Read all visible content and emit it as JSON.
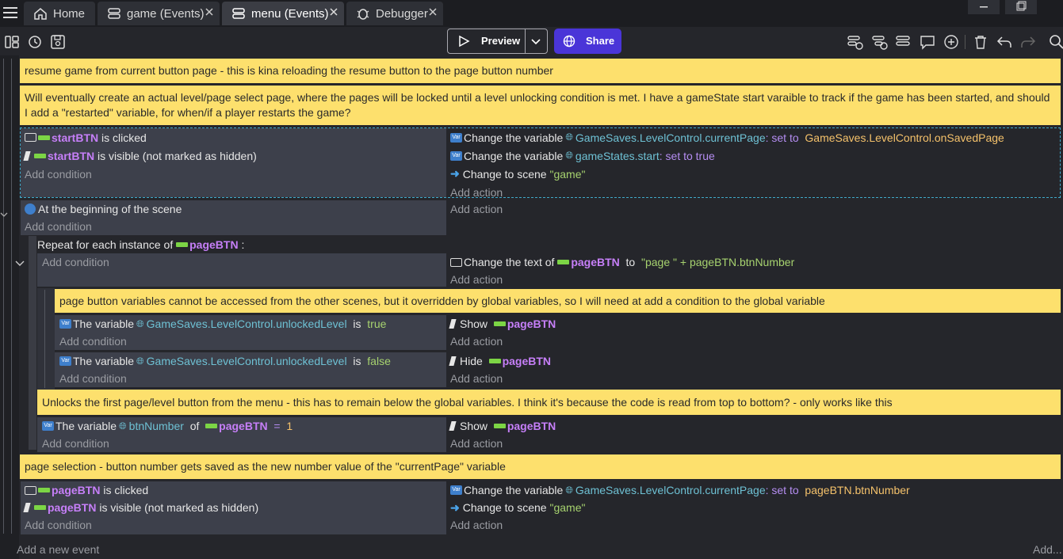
{
  "tabs": [
    {
      "label": "Home",
      "icon": "home-icon"
    },
    {
      "label": "game (Events)",
      "icon": "events-icon"
    },
    {
      "label": "menu (Events)",
      "icon": "events-icon"
    },
    {
      "label": "Debugger",
      "icon": "bug-icon"
    }
  ],
  "toolbar": {
    "preview_label": "Preview",
    "share_label": "Share"
  },
  "colors": {
    "accent": "#4a35d8",
    "comment_bg": "#fde06d",
    "condition_bg": "#3d404b"
  },
  "common": {
    "add_condition": "Add condition",
    "add_action": "Add action",
    "is_clicked": "is clicked",
    "is_visible": "is visible (not marked as hidden)",
    "change_variable": "Change the variable",
    "set_to": "set to",
    "change_scene": "Change to scene",
    "the_variable": "The variable",
    "is_kw": "is",
    "show": "Show",
    "hide": "Hide"
  },
  "comments": {
    "c1": "resume game from current button page - this is kina reloading the resume button to the page button number",
    "c2": "Will eventually create an actual level/page select page, where the pages will be locked until a level unlocking condition is met. I have a gameState start varaible to track if the game has been started, and should I add a \"restarted\" variable, for when/if a player restarts the game?",
    "c3": "page button variables cannot be accessed from the other scenes, but it overridden by global variables, so I will need at add a condition to the global variable",
    "c4": "Unlocks the first page/level button from the menu - this has to remain below the global variables. I think it's because the code is read from top to bottom? - only works like this",
    "c5": "page selection - button number gets saved as the new number value of the \"currentPage\" variable"
  },
  "ev1": {
    "obj": "startBTN",
    "var1": "GameSaves.LevelControl.currentPage",
    "val1": "GameSaves.LevelControl.onSavedPage",
    "var2": "gameStates.start",
    "val2": "true",
    "scene": "\"game\""
  },
  "ev2": {
    "cond": "At the beginning of the scene"
  },
  "ev3": {
    "repeat": "Repeat for each instance of",
    "obj": "pageBTN",
    "colon": ":",
    "change_text": "Change the text of",
    "to_kw": "to",
    "text_expr": "\"page \" + pageBTN.btnNumber"
  },
  "ev4": {
    "var": "GameSaves.LevelControl.unlockedLevel",
    "val": "true"
  },
  "ev5": {
    "var": "GameSaves.LevelControl.unlockedLevel",
    "val": "false"
  },
  "ev6": {
    "var": "btnNumber",
    "of_kw": "of",
    "eq": "=",
    "val": "1"
  },
  "ev7": {
    "obj": "pageBTN",
    "var1": "GameSaves.LevelControl.currentPage",
    "val1": "pageBTN.btnNumber",
    "scene": "\"game\""
  },
  "footer": {
    "add_event": "Add a new event",
    "add_other": "Add..."
  }
}
